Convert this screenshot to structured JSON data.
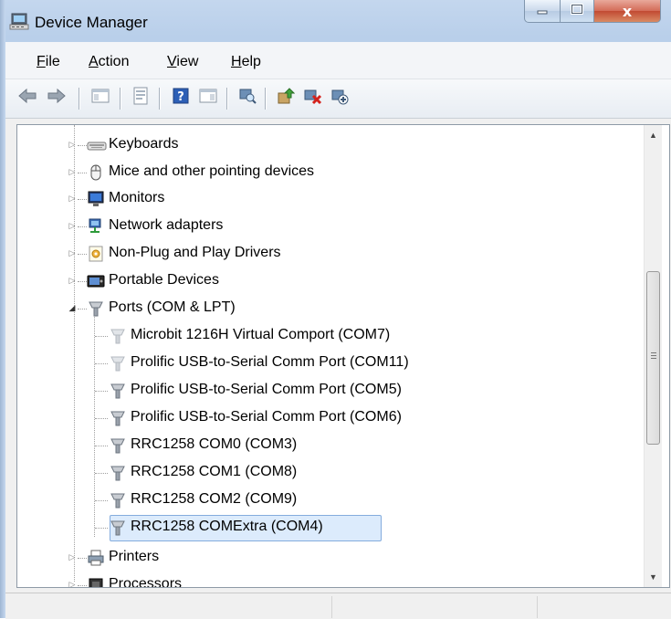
{
  "window": {
    "title": "Device Manager",
    "icons": {
      "app": "device-manager-icon",
      "minimize": "minimize-icon",
      "maximize": "maximize-icon",
      "close": "close-icon"
    },
    "close_glyph": "x"
  },
  "menu": {
    "items": [
      {
        "label": "File",
        "accel": "F"
      },
      {
        "label": "Action",
        "accel": "A"
      },
      {
        "label": "View",
        "accel": "V"
      },
      {
        "label": "Help",
        "accel": "H"
      }
    ]
  },
  "toolbar": {
    "buttons": [
      "back-icon",
      "forward-icon",
      "show-hide-console-tree-icon",
      "properties-icon",
      "help-icon",
      "show-action-pane-icon",
      "scan-hardware-icon",
      "update-driver-icon",
      "uninstall-device-icon",
      "disable-device-icon"
    ]
  },
  "tree": {
    "categories_top": [
      {
        "label": "Keyboards",
        "icon": "keyboard-icon"
      },
      {
        "label": "Mice and other pointing devices",
        "icon": "mouse-icon"
      },
      {
        "label": "Monitors",
        "icon": "monitor-icon"
      },
      {
        "label": "Network adapters",
        "icon": "network-adapter-icon"
      },
      {
        "label": "Non-Plug and Play Drivers",
        "icon": "driver-icon"
      },
      {
        "label": "Portable Devices",
        "icon": "portable-device-icon"
      }
    ],
    "expanded_category": {
      "label": "Ports (COM & LPT)",
      "icon": "port-icon"
    },
    "ports": [
      {
        "label": "Microbit 1216H Virtual Comport (COM7)"
      },
      {
        "label": "Prolific USB-to-Serial Comm Port (COM11)"
      },
      {
        "label": "Prolific USB-to-Serial Comm Port (COM5)"
      },
      {
        "label": "Prolific USB-to-Serial Comm Port (COM6)"
      },
      {
        "label": "RRC1258 COM0 (COM3)"
      },
      {
        "label": "RRC1258 COM1 (COM8)"
      },
      {
        "label": "RRC1258 COM2 (COM9)"
      },
      {
        "label": "RRC1258 COMExtra (COM4)",
        "selected": true
      }
    ],
    "categories_bottom": [
      {
        "label": "Printers",
        "icon": "printer-icon"
      },
      {
        "label": "Processors",
        "icon": "processor-icon"
      }
    ],
    "expander_icons": {
      "collapsed": "expand-arrow-icon",
      "expanded": "collapse-arrow-icon"
    }
  },
  "scrollbar": {
    "up": "scroll-up-icon",
    "down": "scroll-down-icon",
    "thumb_grip": "grip-icon"
  },
  "colors": {
    "selection_bg": "#dcebfc",
    "selection_border": "#84acdd",
    "frame": "#c4d7ee"
  }
}
